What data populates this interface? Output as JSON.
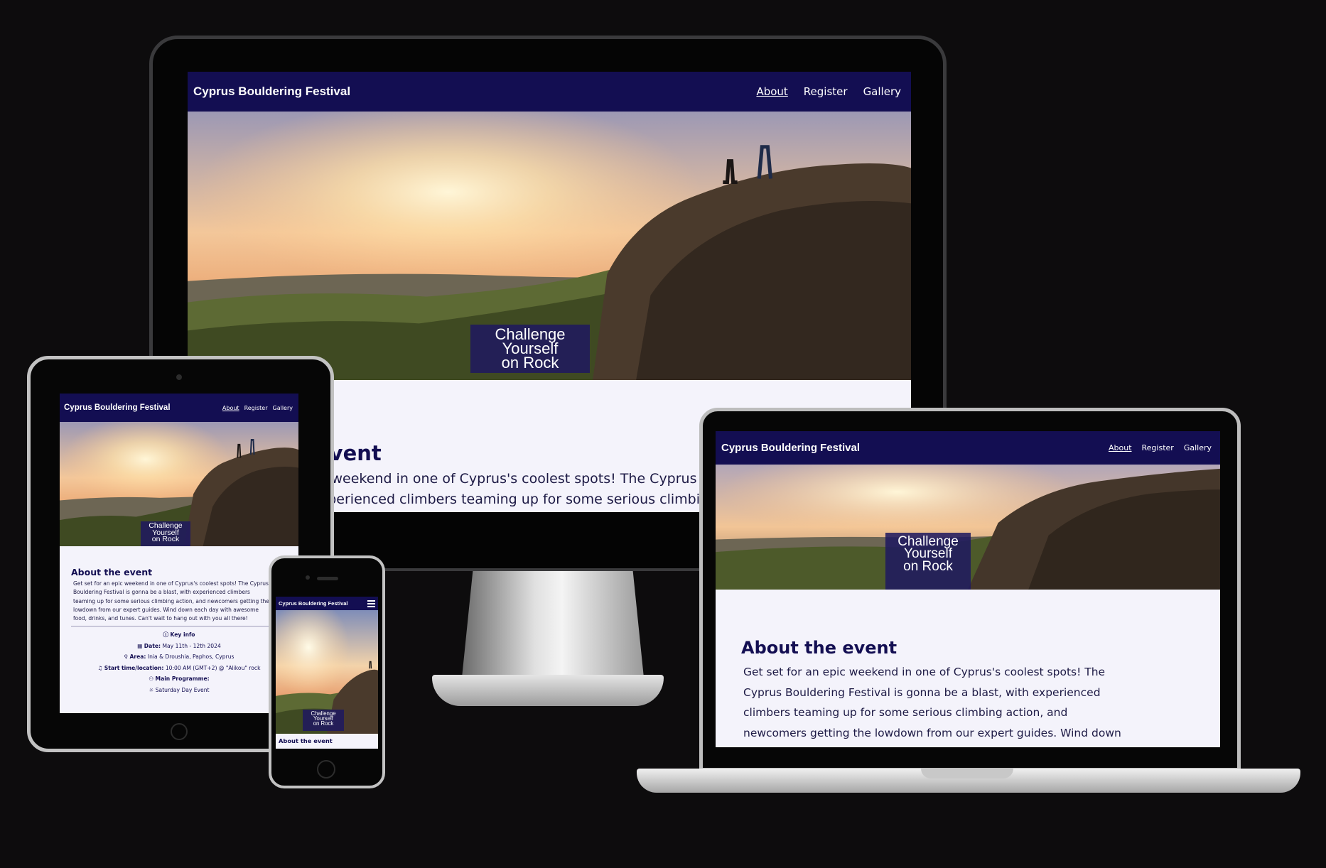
{
  "site": {
    "brand": "Cyprus Bouldering Festival",
    "nav": [
      "About",
      "Register",
      "Gallery"
    ],
    "hero_badge": [
      "Challenge",
      "Yourself",
      "on Rock"
    ]
  },
  "monitor": {
    "heading": "event",
    "line1": "c weekend in one of Cyprus's coolest spots! The Cyprus B",
    "line2": "xperienced climbers teaming up for some serious climbing"
  },
  "laptop": {
    "heading": "About the event",
    "paragraph": "Get set for an epic weekend in one of Cyprus's coolest spots! The Cyprus Bouldering Festival is gonna be a blast, with experienced climbers teaming up for some serious climbing action, and newcomers getting the lowdown from our expert guides. Wind down each day with awesome food, drinks, and tunes. Can't"
  },
  "tablet": {
    "heading": "About the event",
    "paragraph": "Get set for an epic weekend in one of Cyprus's coolest spots! The Cyprus Bouldering Festival is gonna be a blast, with experienced climbers teaming up for some serious climbing action, and newcomers getting the lowdown from our expert guides. Wind down each day with awesome food, drinks, and tunes. Can't wait to hang out with you all there!",
    "key_info": {
      "title": "Key info",
      "date_label": "Date:",
      "date_value": "May 11th - 12th 2024",
      "area_label": "Area:",
      "area_value": "Inia & Droushia, Paphos, Cyprus",
      "start_label": "Start time/location:",
      "start_value": "10:00 AM (GMT+2) @ \"Alikou\" rock",
      "programme_label": "Main Programme:",
      "programme_item": "Saturday Day Event"
    }
  },
  "phone": {
    "heading": "About the event"
  },
  "colors": {
    "nav": "#130e52",
    "page_bg": "#f4f3fb",
    "heading": "#130e52",
    "backdrop": "#0d0c0d"
  }
}
